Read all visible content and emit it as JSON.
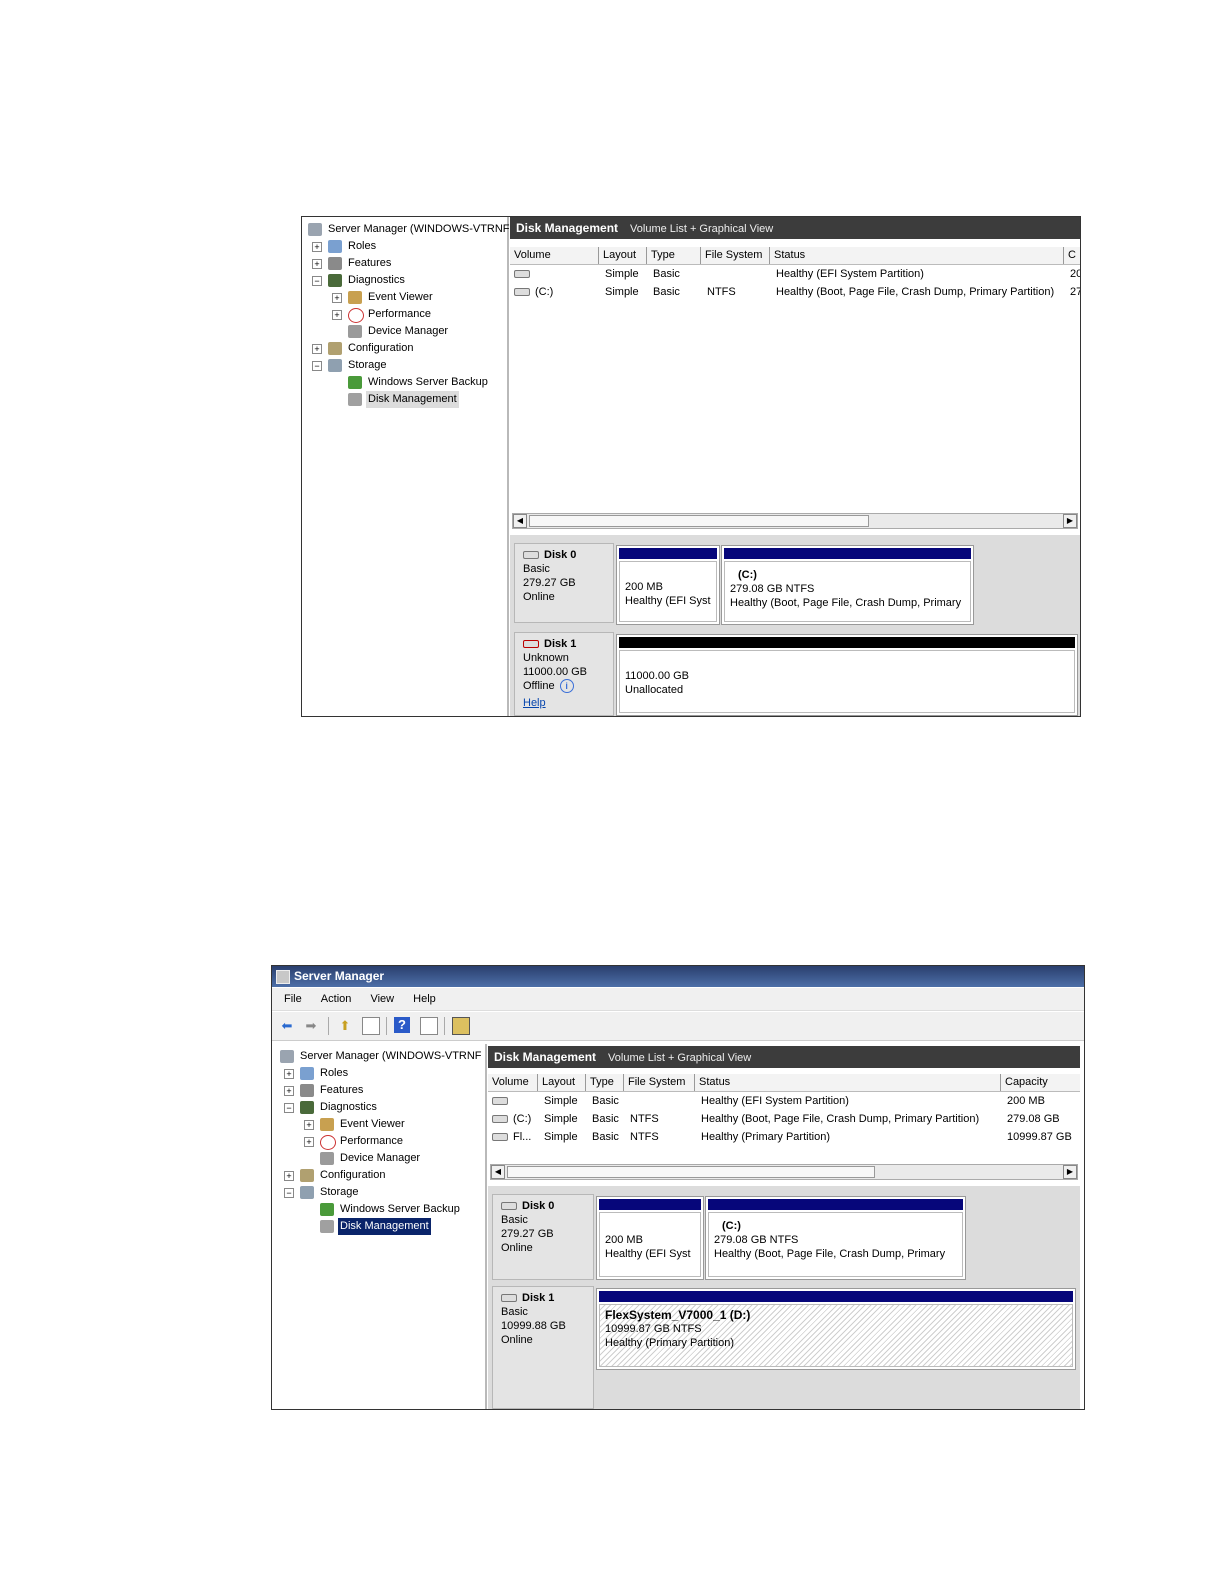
{
  "shot1": {
    "tree": {
      "root": "Server Manager (WINDOWS-VTRNF",
      "items": [
        {
          "label": "Roles",
          "icon": "roles-icon"
        },
        {
          "label": "Features",
          "icon": "features-icon"
        },
        {
          "label": "Diagnostics",
          "icon": "diagnostics-icon"
        },
        {
          "label": "Event Viewer",
          "icon": "event-viewer-icon"
        },
        {
          "label": "Performance",
          "icon": "performance-icon"
        },
        {
          "label": "Device Manager",
          "icon": "device-manager-icon"
        },
        {
          "label": "Configuration",
          "icon": "configuration-icon"
        },
        {
          "label": "Storage",
          "icon": "storage-icon"
        },
        {
          "label": "Windows Server Backup",
          "icon": "backup-icon"
        },
        {
          "label": "Disk Management",
          "icon": "disk-management-icon"
        }
      ]
    },
    "header": {
      "title": "Disk Management",
      "subtitle": "Volume List + Graphical View"
    },
    "columns": [
      "Volume",
      "Layout",
      "Type",
      "File System",
      "Status",
      "C"
    ],
    "rows": [
      {
        "volume": "",
        "layout": "Simple",
        "type": "Basic",
        "fs": "",
        "status": "Healthy (EFI System Partition)",
        "cap": "20"
      },
      {
        "volume": "(C:)",
        "layout": "Simple",
        "type": "Basic",
        "fs": "NTFS",
        "status": "Healthy (Boot, Page File, Crash Dump, Primary Partition)",
        "cap": "27"
      }
    ],
    "disk0": {
      "name": "Disk 0",
      "type": "Basic",
      "size": "279.27 GB",
      "state": "Online",
      "p1": {
        "size": "200 MB",
        "status": "Healthy (EFI Syst"
      },
      "p2": {
        "label": "(C:)",
        "size": "279.08 GB NTFS",
        "status": "Healthy (Boot, Page File, Crash Dump, Primary"
      }
    },
    "disk1": {
      "name": "Disk 1",
      "type": "Unknown",
      "size": "11000.00 GB",
      "state": "Offline",
      "help": "Help",
      "p1": {
        "size": "11000.00 GB",
        "status": "Unallocated"
      }
    }
  },
  "shot2": {
    "title": "Server Manager",
    "menu": [
      "File",
      "Action",
      "View",
      "Help"
    ],
    "tree": {
      "root": "Server Manager (WINDOWS-VTRNF",
      "items": [
        {
          "label": "Roles",
          "icon": "roles-icon"
        },
        {
          "label": "Features",
          "icon": "features-icon"
        },
        {
          "label": "Diagnostics",
          "icon": "diagnostics-icon"
        },
        {
          "label": "Event Viewer",
          "icon": "event-viewer-icon"
        },
        {
          "label": "Performance",
          "icon": "performance-icon"
        },
        {
          "label": "Device Manager",
          "icon": "device-manager-icon"
        },
        {
          "label": "Configuration",
          "icon": "configuration-icon"
        },
        {
          "label": "Storage",
          "icon": "storage-icon"
        },
        {
          "label": "Windows Server Backup",
          "icon": "backup-icon"
        },
        {
          "label": "Disk Management",
          "icon": "disk-management-icon"
        }
      ]
    },
    "header": {
      "title": "Disk Management",
      "subtitle": "Volume List + Graphical View"
    },
    "columns": [
      "Volume",
      "Layout",
      "Type",
      "File System",
      "Status",
      "Capacity"
    ],
    "rows": [
      {
        "volume": "",
        "layout": "Simple",
        "type": "Basic",
        "fs": "",
        "status": "Healthy (EFI System Partition)",
        "cap": "200 MB"
      },
      {
        "volume": "(C:)",
        "layout": "Simple",
        "type": "Basic",
        "fs": "NTFS",
        "status": "Healthy (Boot, Page File, Crash Dump, Primary Partition)",
        "cap": "279.08 GB"
      },
      {
        "volume": "Fl...",
        "layout": "Simple",
        "type": "Basic",
        "fs": "NTFS",
        "status": "Healthy (Primary Partition)",
        "cap": "10999.87 GB"
      }
    ],
    "disk0": {
      "name": "Disk 0",
      "type": "Basic",
      "size": "279.27 GB",
      "state": "Online",
      "p1": {
        "size": "200 MB",
        "status": "Healthy (EFI Syst"
      },
      "p2": {
        "label": "(C:)",
        "size": "279.08 GB NTFS",
        "status": "Healthy (Boot, Page File, Crash Dump, Primary"
      }
    },
    "disk1": {
      "name": "Disk 1",
      "type": "Basic",
      "size": "10999.88 GB",
      "state": "Online",
      "p1": {
        "label": "FlexSystem_V7000_1  (D:)",
        "size": "10999.87 GB NTFS",
        "status": "Healthy (Primary Partition)"
      }
    }
  }
}
